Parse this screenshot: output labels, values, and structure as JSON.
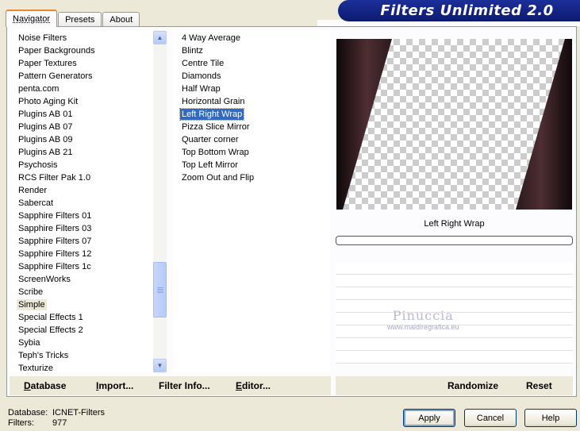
{
  "window": {
    "title": "Filters Unlimited 2.0"
  },
  "tabs": [
    {
      "label": "Navigator",
      "active": true
    },
    {
      "label": "Presets",
      "active": false
    },
    {
      "label": "About",
      "active": false
    }
  ],
  "categories": {
    "items": [
      "Noise Filters",
      "Paper Backgrounds",
      "Paper Textures",
      "Pattern Generators",
      "penta.com",
      "Photo Aging Kit",
      "Plugins AB 01",
      "Plugins AB 07",
      "Plugins AB 09",
      "Plugins AB 21",
      "Psychosis",
      "RCS Filter Pak 1.0",
      "Render",
      "Sabercat",
      "Sapphire Filters 01",
      "Sapphire Filters 03",
      "Sapphire Filters 07",
      "Sapphire Filters 12",
      "Sapphire Filters 1c",
      "ScreenWorks",
      "Scribe",
      "Simple",
      "Special Effects 1",
      "Special Effects 2",
      "Sybia",
      "Teph's Tricks",
      "Texturize"
    ],
    "selected": "Simple"
  },
  "filters": {
    "items": [
      "4 Way Average",
      "Blintz",
      "Centre Tile",
      "Diamonds",
      "Half Wrap",
      "Horizontal Grain",
      "Left Right Wrap",
      "Pizza Slice Mirror",
      "Quarter corner",
      "Top Bottom Wrap",
      "Top Left Mirror",
      "Zoom Out and Flip"
    ],
    "selected": "Left Right Wrap"
  },
  "preview": {
    "filter_name": "Left Right Wrap",
    "progress": 0,
    "colors": {
      "dark": "#2a1a1c",
      "mid": "#4e2e32",
      "edge": "#0e0809"
    }
  },
  "watermark": {
    "name": "Pinuccia",
    "url": "www.maidiregrafica.eu"
  },
  "toolbar_left": {
    "database": {
      "underlined": "D",
      "rest": "atabase"
    },
    "import": {
      "underlined": "I",
      "rest": "mport..."
    },
    "filter_info": {
      "underlined": "Filter I",
      "rest": "nfo..."
    },
    "editor": {
      "underlined": "E",
      "rest": "ditor..."
    }
  },
  "toolbar_right": {
    "randomize": "Randomize",
    "reset": "Reset"
  },
  "footer": {
    "database_label": "Database:",
    "database_value": "ICNET-Filters",
    "filters_label": "Filters:",
    "filters_value": "977"
  },
  "buttons": {
    "apply": "Apply",
    "cancel": "Cancel",
    "help": "Help"
  }
}
